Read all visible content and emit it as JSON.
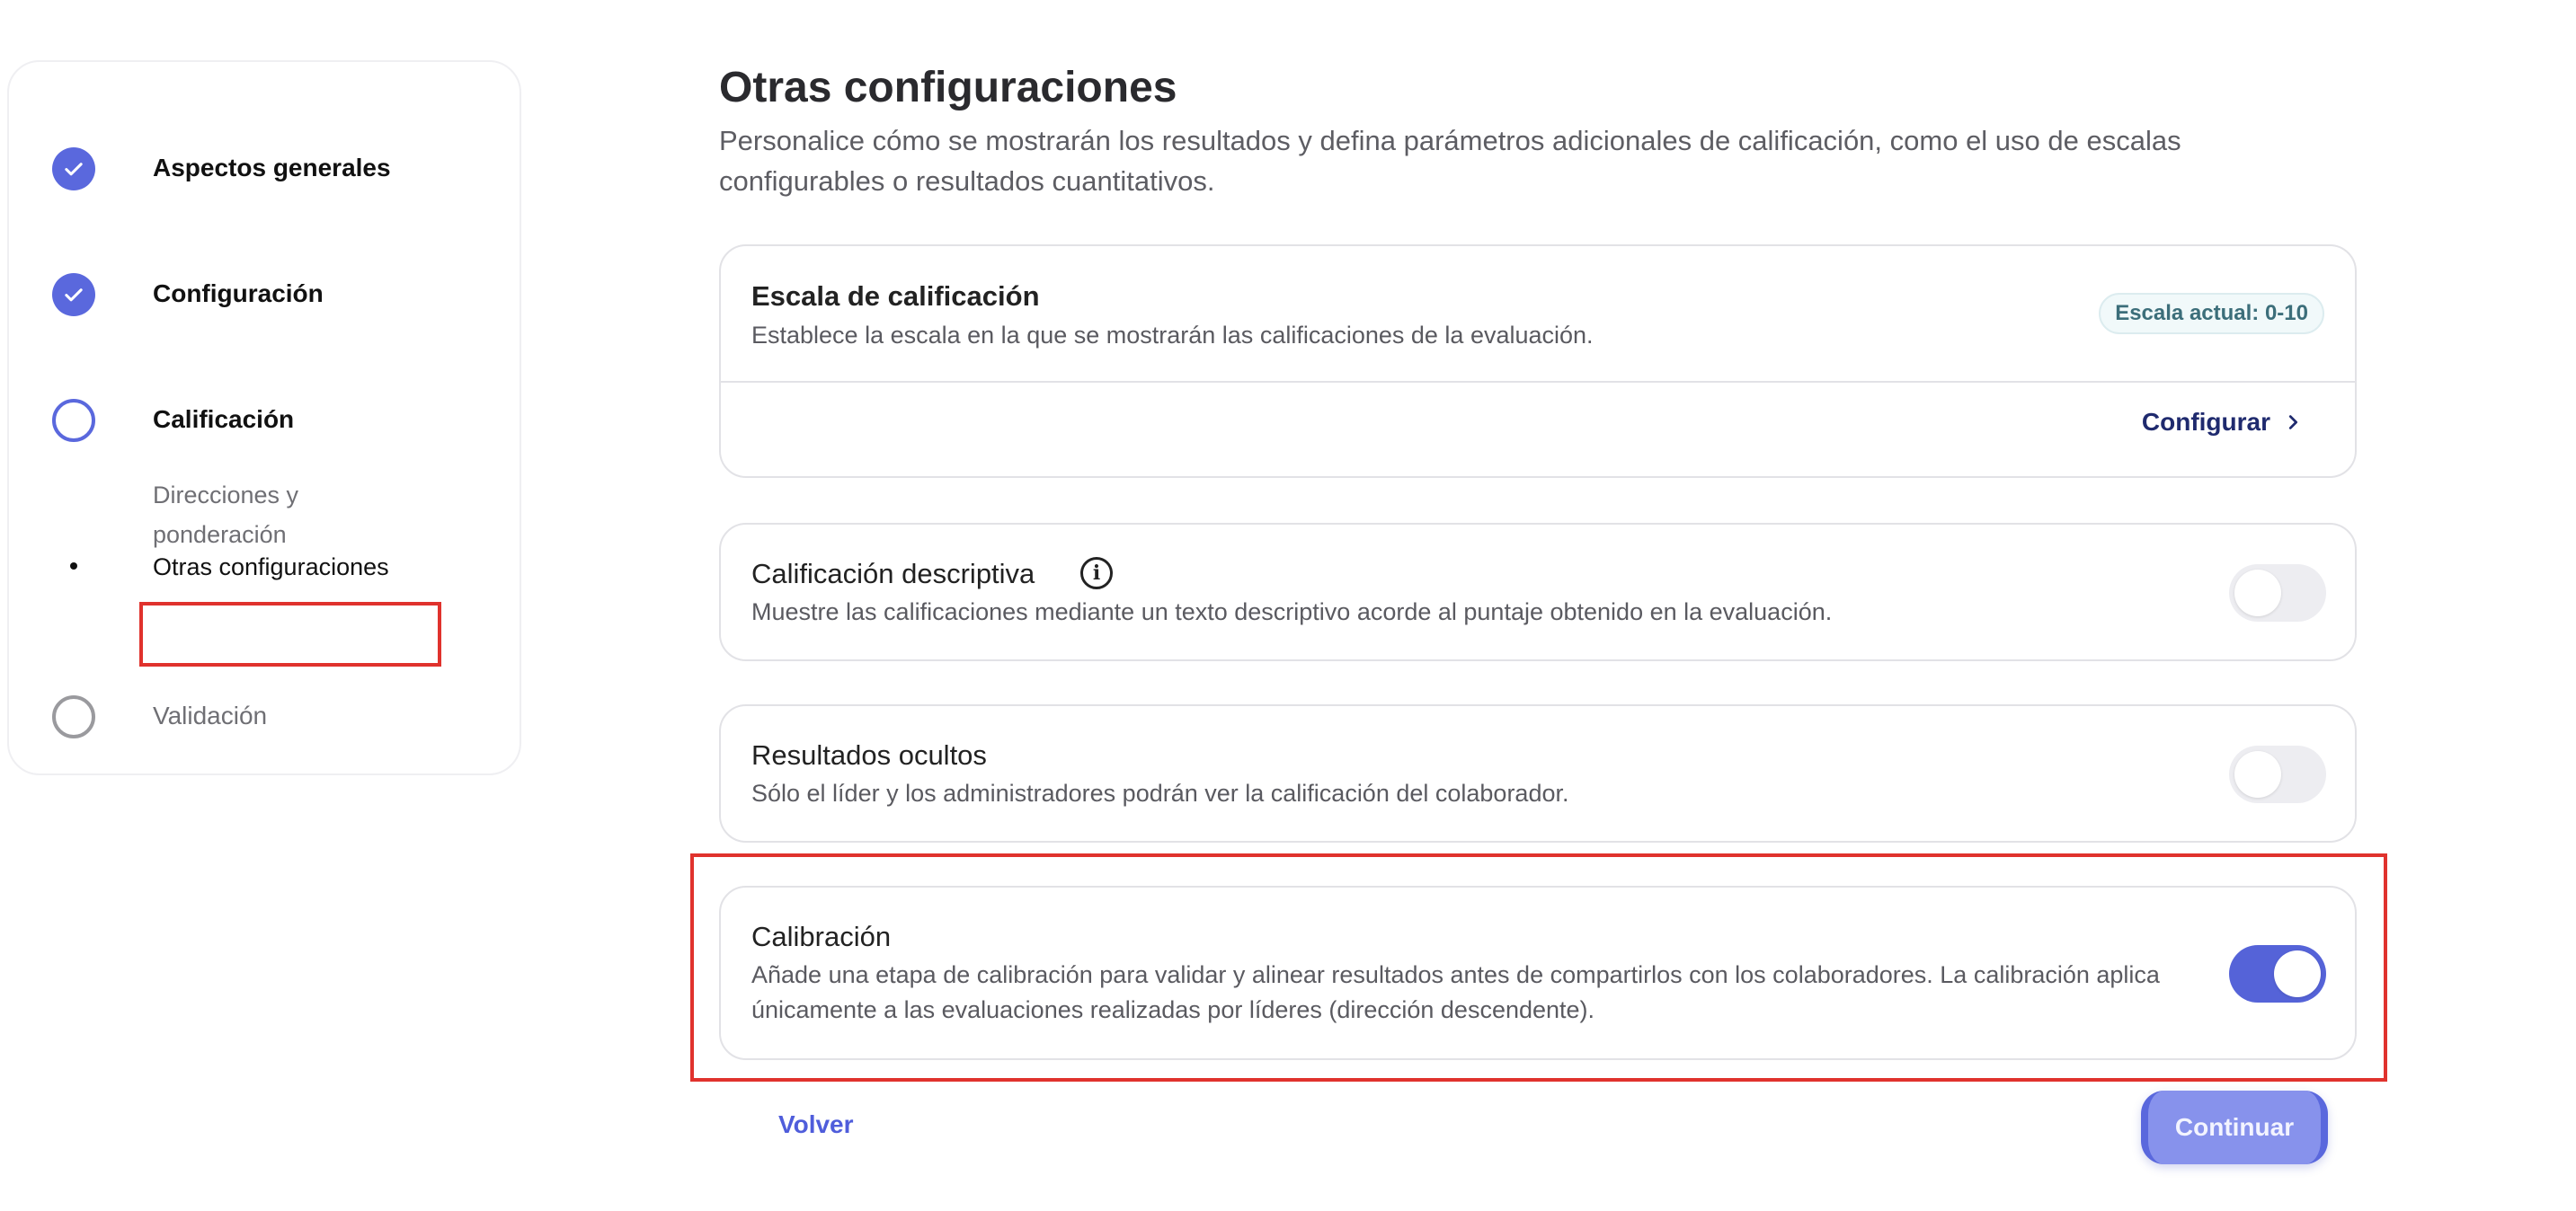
{
  "stepper": {
    "steps": [
      {
        "label": "Aspectos generales",
        "state": "done"
      },
      {
        "label": "Configuración",
        "state": "done"
      },
      {
        "label": "Calificación",
        "state": "current"
      },
      {
        "label": "Validación",
        "state": "pending"
      }
    ],
    "substeps": [
      {
        "label": "Direcciones y ponderación",
        "active": false
      },
      {
        "label": "Otras configuraciones",
        "active": true
      }
    ]
  },
  "main": {
    "title": "Otras configuraciones",
    "description": "Personalice cómo se mostrarán los resultados y defina parámetros adicionales de calificación, como el uso de escalas configurables o resultados cuantitativos."
  },
  "scale_card": {
    "title": "Escala de calificación",
    "description": "Establece la escala en la que se mostrarán las calificaciones de la evaluación.",
    "badge": "Escala actual: 0-10",
    "action_label": "Configurar"
  },
  "options": [
    {
      "title": "Calificación descriptiva",
      "description": "Muestre las calificaciones mediante un texto descriptivo acorde al puntaje obtenido en la evaluación.",
      "enabled": false
    },
    {
      "title": "Resultados ocultos",
      "description": "Sólo el líder y los administradores podrán ver la calificación del colaborador.",
      "enabled": false
    },
    {
      "title": "Calibración",
      "description": "Añade una etapa de calibración para validar y alinear resultados antes de compartirlos con los colaboradores. La calibración aplica únicamente a las evaluaciones realizadas por líderes (dirección descendente).",
      "enabled": true
    }
  ],
  "footer": {
    "back_label": "Volver",
    "continue_label": "Continuar"
  },
  "colors": {
    "accent": "#5a68dd",
    "highlight": "#e0322d"
  }
}
